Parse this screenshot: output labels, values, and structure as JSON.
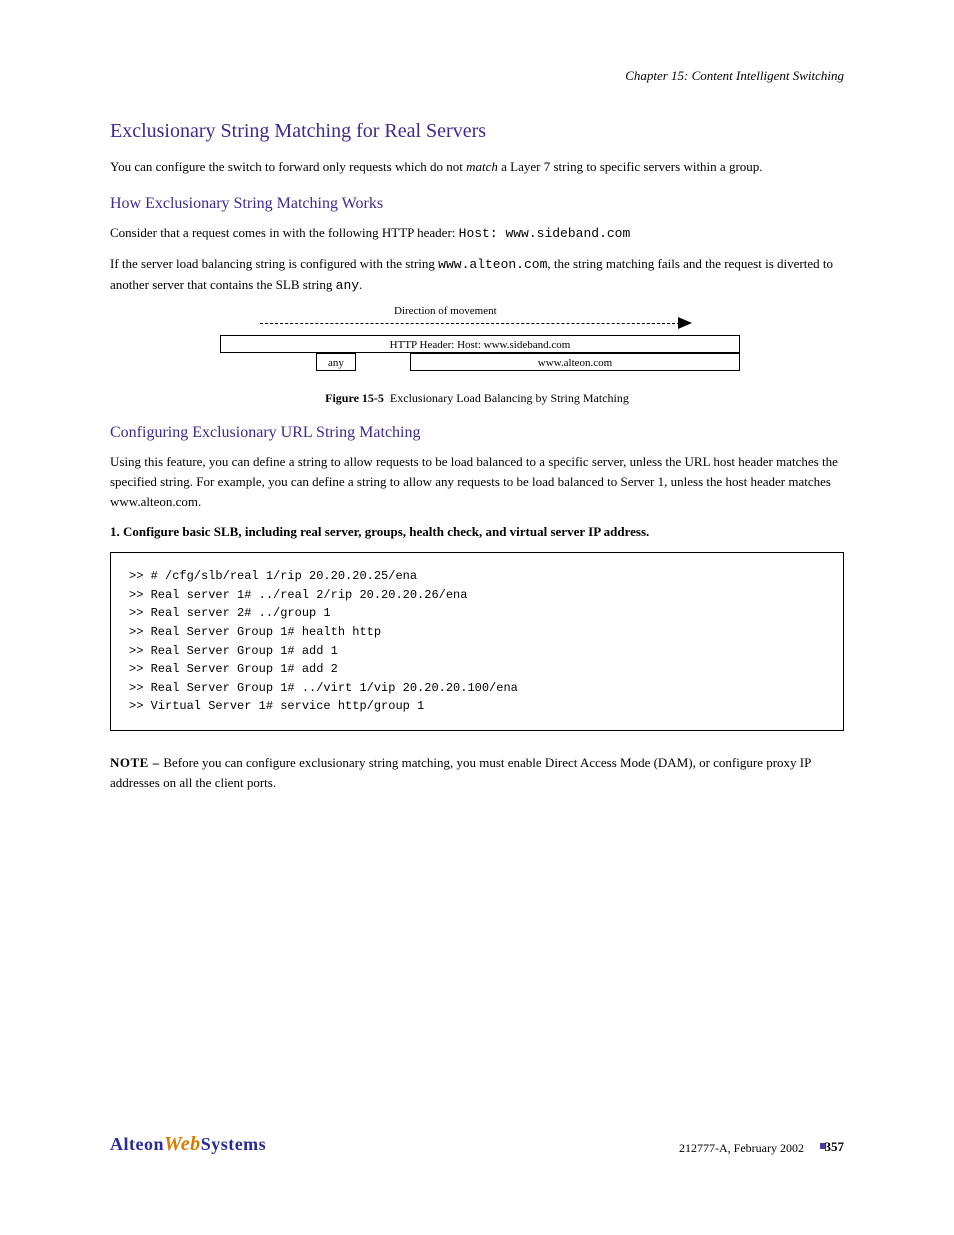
{
  "chapter_header": "Chapter 15: Content Intelligent Switching",
  "h2": "Exclusionary String Matching for Real Servers",
  "p1_a": "You can configure the switch to forward only requests which do not ",
  "p1_b": "match",
  "p1_c": " a Layer 7 string to specific servers within a group.",
  "h3a": "How Exclusionary String Matching Works",
  "p2_a": "Consider that a request comes in with the following HTTP header: ",
  "p2_b": "Host: www.sideband.com",
  "p3_a": "If the server load balancing string is configured with the string ",
  "p3_b": "www.alteon.com",
  "p3_c": ", the string matching fails and the request is diverted to another server that contains the SLB string ",
  "p3_d": "any",
  "p3_e": ".",
  "diagram": {
    "arrow_label": "Direction of movement",
    "main_box": "HTTP Header: Host: www.sideband.com",
    "sub1": "any",
    "sub2": "www.alteon.com",
    "caption_tag": "Figure 15-5",
    "caption_text": "Exclusionary Load Balancing by String Matching"
  },
  "h3b": "Configuring Exclusionary URL String Matching",
  "p4": "Using this feature, you can define a string to allow requests to be load balanced to a specific server, unless the URL host header matches the specified string. For example, you can define a string to allow any requests to be load balanced to Server 1, unless the host header matches www.alteon.com.",
  "step1": "1. Configure basic SLB, including real server, groups, health check, and virtual server IP address.",
  "code": ">> # /cfg/slb/real 1/rip 20.20.20.25/ena\n>> Real server 1# ../real 2/rip 20.20.20.26/ena\n>> Real server 2# ../group 1\n>> Real Server Group 1# health http\n>> Real Server Group 1# add 1\n>> Real Server Group 1# add 2\n>> Real Server Group 1# ../virt 1/vip 20.20.20.100/ena\n>> Virtual Server 1# service http/group 1",
  "note_label": "NOTE – ",
  "note_text": "Before you can configure exclusionary string matching, you must enable Direct Access Mode (DAM), or configure proxy IP addresses on all the client ports.",
  "footer": {
    "text": "212777-A, February 2002",
    "page": "357",
    "logo": {
      "a": "Alteon",
      "b": "Web",
      "c": "Systems"
    }
  }
}
